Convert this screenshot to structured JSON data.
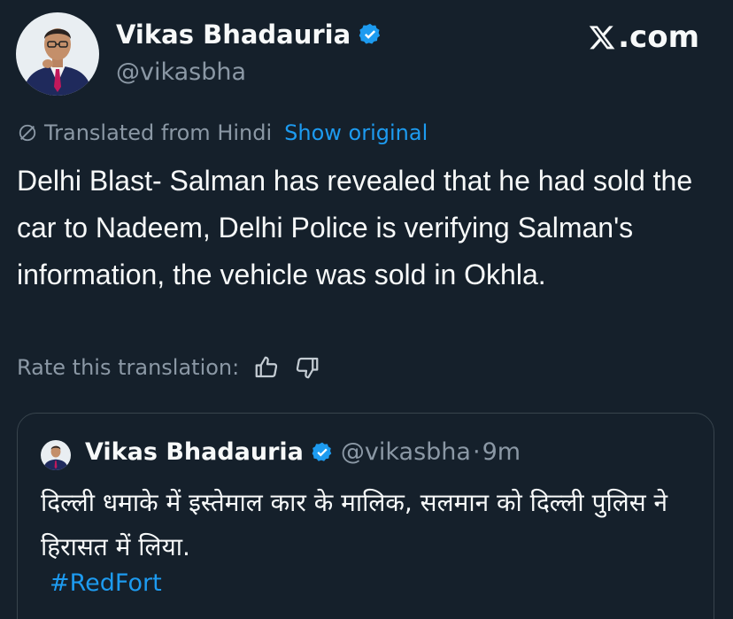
{
  "author": {
    "name": "Vikas Bhadauria",
    "handle": "@vikasbha"
  },
  "site": {
    "logo_text": ".com",
    "logo_icon": "x-logo-icon"
  },
  "translation": {
    "label": "Translated from Hindi",
    "show_original": "Show original",
    "rate_label": "Rate this translation:"
  },
  "tweet": {
    "text": "Delhi Blast- Salman has revealed that he had sold the car to Nadeem, Delhi Police is verifying Salman's information, the vehicle was sold in Okhla."
  },
  "quoted_tweet": {
    "name": "Vikas Bhadauria",
    "handle": "@vikasbha",
    "dot": "·",
    "time": "9m",
    "text": "दिल्ली धमाके में इस्तेमाल कार के मालिक, सलमान को दिल्ली पुलिस ने हिरासत में लिया.",
    "hashtag": "#RedFort"
  },
  "colors": {
    "background": "#15202b",
    "accent": "#1d9bf0",
    "muted": "#8b98a5",
    "border": "#38444d"
  }
}
